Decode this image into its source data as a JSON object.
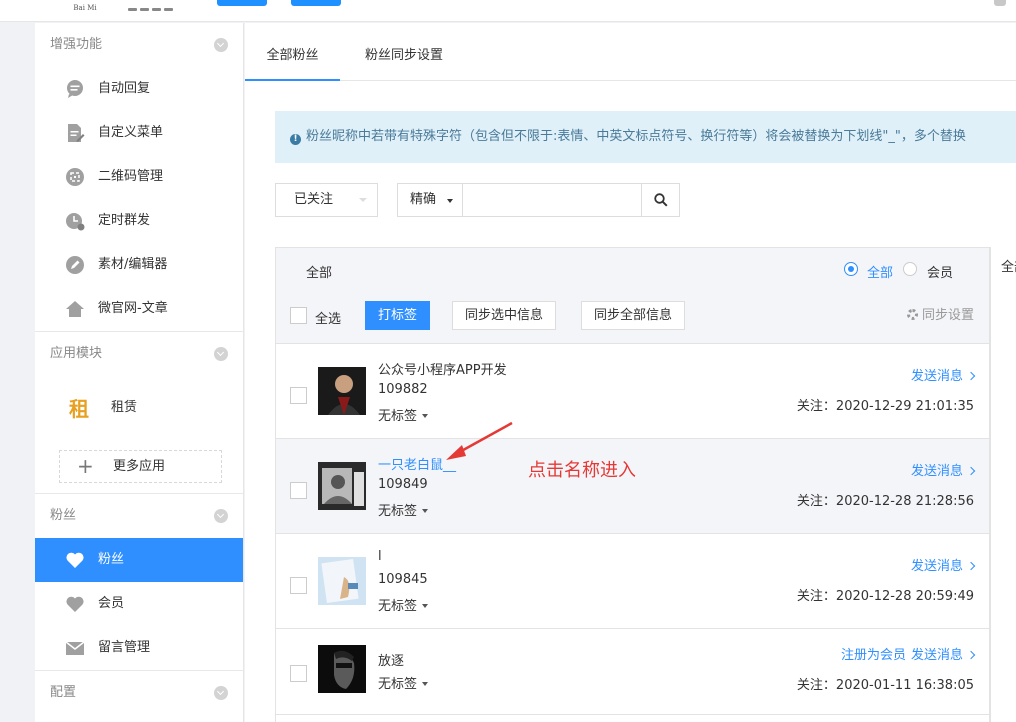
{
  "header": {
    "logo_line1": "",
    "logo_line2": "Bai Mi"
  },
  "sidebar": {
    "sections": [
      {
        "title": "增强功能"
      },
      {
        "title": "应用模块"
      },
      {
        "title": "粉丝"
      },
      {
        "title": "配置"
      }
    ],
    "enhance_items": [
      "自动回复",
      "自定义菜单",
      "二维码管理",
      "定时群发",
      "素材/编辑器",
      "微官网-文章"
    ],
    "app_item": "租赁",
    "more_apps": "更多应用",
    "fans_items": [
      "粉丝",
      "会员",
      "留言管理"
    ]
  },
  "tabs": [
    "全部粉丝",
    "粉丝同步设置"
  ],
  "notice": "粉丝昵称中若带有特殊字符（包含但不限于:表情、中英文标点符号、换行符等）将会被替换为下划线\"_\"，多个替换",
  "filters": {
    "status": "已关注",
    "precise": "精确"
  },
  "list_head": {
    "group_label": "全部",
    "radio_all": "全部",
    "radio_member": "会员",
    "select_all": "全选",
    "tag_button": "打标签",
    "sync_selected": "同步选中信息",
    "sync_all": "同步全部信息",
    "sync_settings": "同步设置"
  },
  "fans": [
    {
      "nickname": "公众号小程序APP开发",
      "id": "109882",
      "tag": "无标签",
      "action": "发送消息",
      "follow": "关注：2020-12-29 21:01:35"
    },
    {
      "nickname": "一只老白鼠__",
      "id": "109849",
      "tag": "无标签",
      "action": "发送消息",
      "follow": "关注：2020-12-28 21:28:56"
    },
    {
      "nickname": "l",
      "id": "109845",
      "tag": "无标签",
      "action": "发送消息",
      "follow": "关注：2020-12-28 20:59:49"
    },
    {
      "nickname": "放逐",
      "tag": "无标签",
      "action_register": "注册为会员",
      "action": "发送消息",
      "follow": "关注：2020-01-11 16:38:05"
    }
  ],
  "right_peek": "全部",
  "annotation": "点击名称进入",
  "colors": {
    "primary": "#2f8fff",
    "annotation": "#e53935",
    "notice_bg": "#dff0f8"
  }
}
